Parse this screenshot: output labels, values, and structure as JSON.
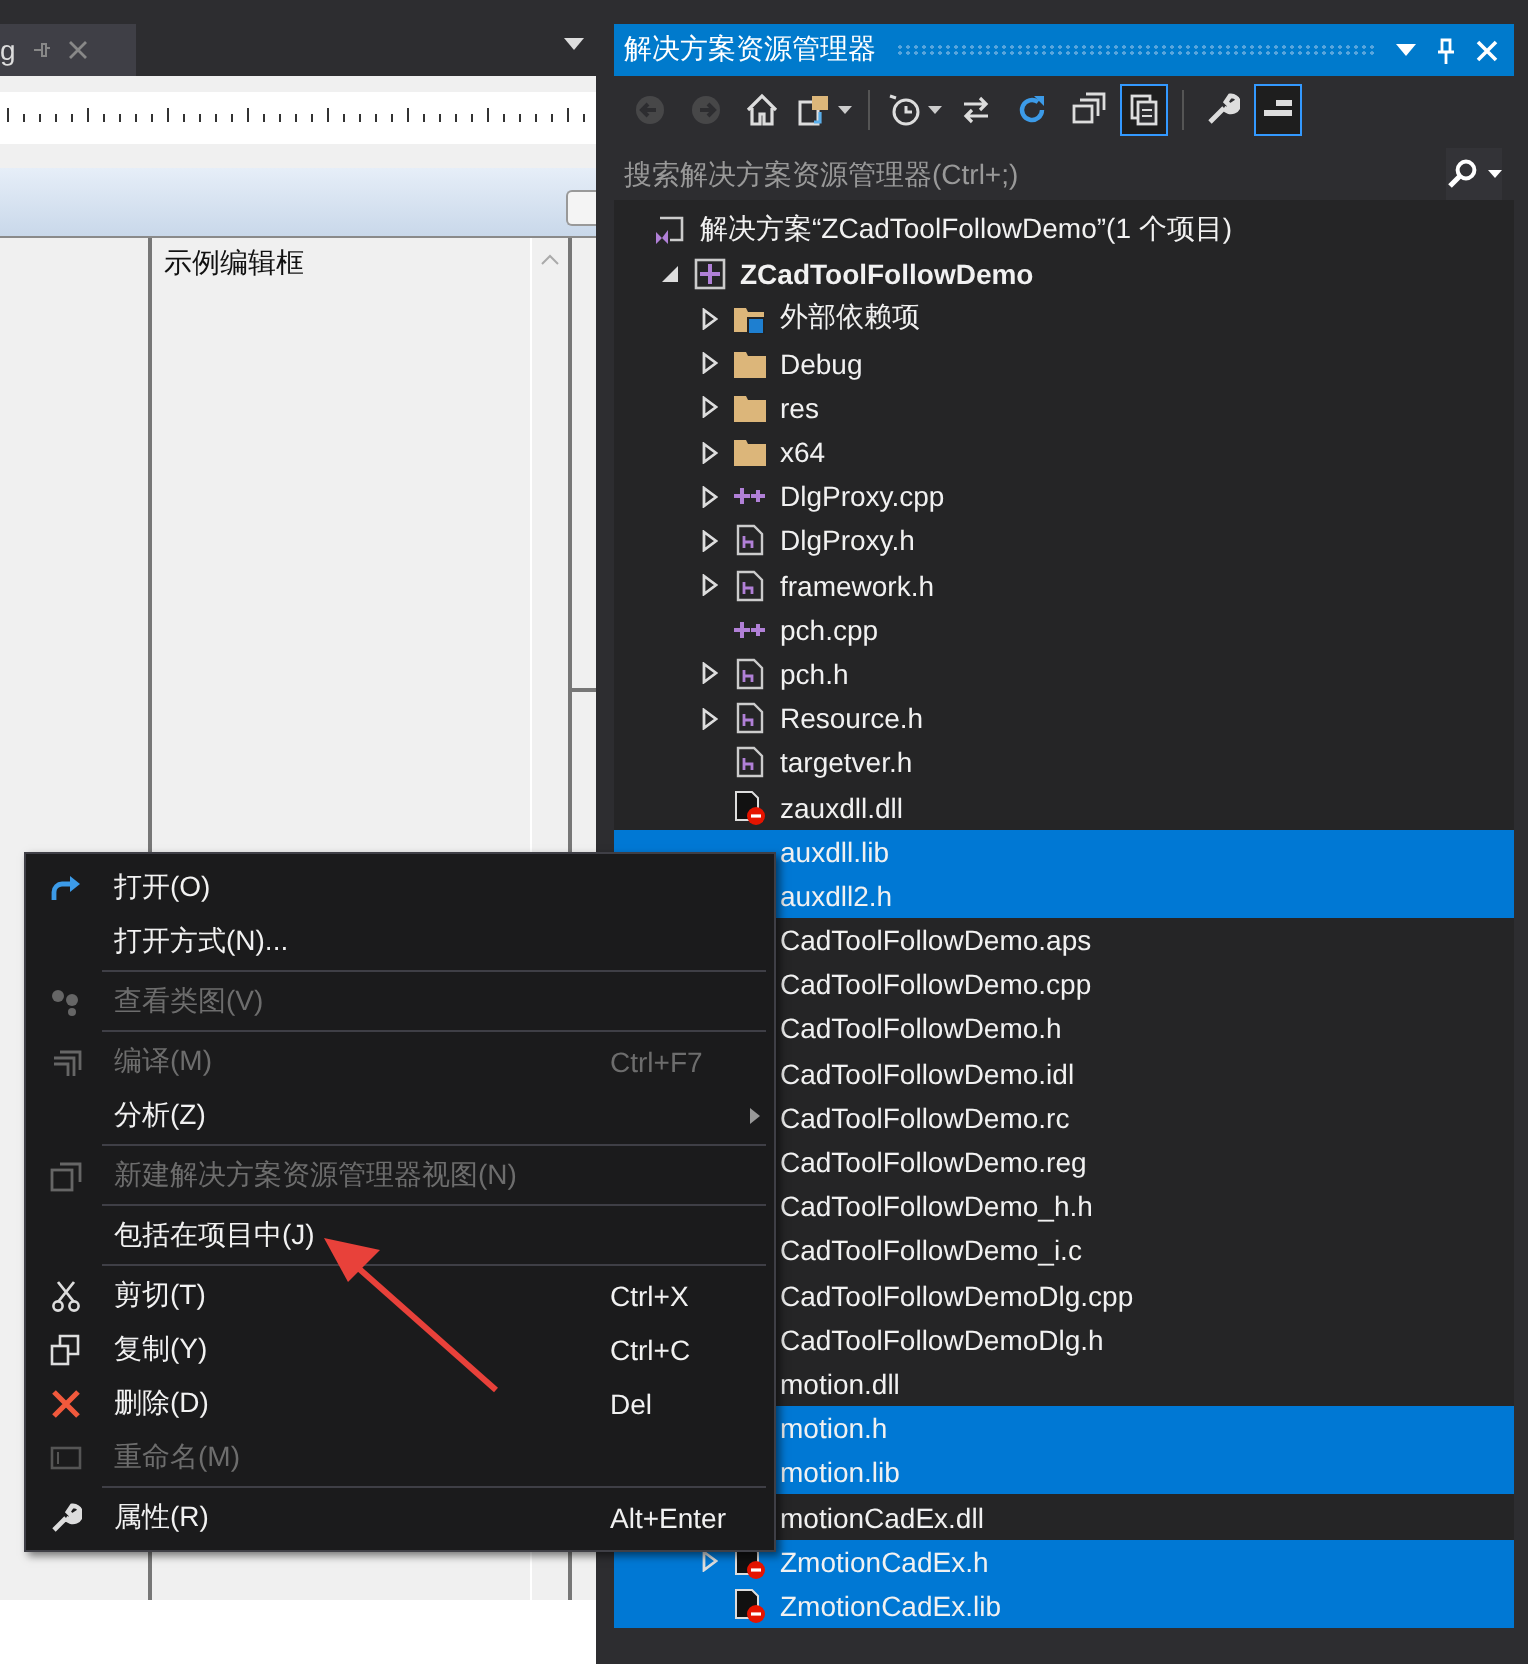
{
  "document_tab": {
    "label": "g"
  },
  "designer": {
    "edit_label": "示例编辑框"
  },
  "solution_explorer": {
    "title": "解决方案资源管理器",
    "toolbar": [
      {
        "kind": "back",
        "disabled": true,
        "toggled": false
      },
      {
        "kind": "forward",
        "disabled": true,
        "toggled": false
      },
      {
        "kind": "home",
        "disabled": false,
        "toggled": false
      },
      {
        "kind": "views",
        "disabled": false,
        "toggled": false
      },
      {
        "kind": "separator"
      },
      {
        "kind": "history",
        "disabled": false,
        "toggled": false
      },
      {
        "kind": "sync",
        "disabled": false,
        "toggled": false
      },
      {
        "kind": "refresh",
        "disabled": false,
        "toggled": false
      },
      {
        "kind": "collapse",
        "disabled": false,
        "toggled": false
      },
      {
        "kind": "show-all",
        "disabled": false,
        "toggled": true
      },
      {
        "kind": "separator"
      },
      {
        "kind": "properties",
        "disabled": false,
        "toggled": false
      },
      {
        "kind": "preview",
        "disabled": false,
        "toggled": true
      }
    ],
    "search": {
      "placeholder": "搜索解决方案资源管理器(Ctrl+;)"
    },
    "tree": [
      {
        "name": "解决方案“ZCadToolFollowDemo”(1 个项目)",
        "kind": "solution",
        "selected": false,
        "children": [
          {
            "name": "ZCadToolFollowDemo",
            "kind": "project",
            "expanded": true,
            "selected": false,
            "children": [
              {
                "name": "外部依赖项",
                "kind": "references",
                "expanded": false,
                "selected": false
              },
              {
                "name": "Debug",
                "kind": "folder",
                "expanded": false,
                "selected": false
              },
              {
                "name": "res",
                "kind": "folder",
                "expanded": false,
                "selected": false
              },
              {
                "name": "x64",
                "kind": "folder",
                "expanded": false,
                "selected": false
              },
              {
                "name": "DlgProxy.cpp",
                "kind": "cpp",
                "expanded": false,
                "selected": false
              },
              {
                "name": "DlgProxy.h",
                "kind": "header",
                "expanded": false,
                "selected": false
              },
              {
                "name": "framework.h",
                "kind": "header",
                "expanded": false,
                "selected": false
              },
              {
                "name": "pch.cpp",
                "kind": "cpp",
                "selected": false
              },
              {
                "name": "pch.h",
                "kind": "header",
                "expanded": false,
                "selected": false
              },
              {
                "name": "Resource.h",
                "kind": "header",
                "expanded": false,
                "selected": false
              },
              {
                "name": "targetver.h",
                "kind": "header",
                "selected": false
              },
              {
                "name": "zauxdll.dll",
                "kind": "excluded",
                "selected": false
              },
              {
                "name": "auxdll.lib",
                "selected": true
              },
              {
                "name": "auxdll2.h",
                "selected": true
              },
              {
                "name": "CadToolFollowDemo.aps",
                "selected": false
              },
              {
                "name": "CadToolFollowDemo.cpp",
                "selected": false
              },
              {
                "name": "CadToolFollowDemo.h",
                "selected": false
              },
              {
                "name": "CadToolFollowDemo.idl",
                "selected": false
              },
              {
                "name": "CadToolFollowDemo.rc",
                "selected": false
              },
              {
                "name": "CadToolFollowDemo.reg",
                "selected": false
              },
              {
                "name": "CadToolFollowDemo_h.h",
                "selected": false
              },
              {
                "name": "CadToolFollowDemo_i.c",
                "selected": false
              },
              {
                "name": "CadToolFollowDemoDlg.cpp",
                "selected": false
              },
              {
                "name": "CadToolFollowDemoDlg.h",
                "selected": false
              },
              {
                "name": "motion.dll",
                "selected": false
              },
              {
                "name": "motion.h",
                "selected": true
              },
              {
                "name": "motion.lib",
                "selected": true
              },
              {
                "name": "motionCadEx.dll",
                "selected": false
              },
              {
                "name": "ZmotionCadEx.h",
                "kind": "excluded",
                "expanded": false,
                "selected": true
              },
              {
                "name": "ZmotionCadEx.lib",
                "kind": "excluded",
                "selected": true
              }
            ]
          }
        ]
      }
    ]
  },
  "context_menu": {
    "groups": [
      [
        {
          "kind": "open",
          "label": "打开(O)",
          "disabled": false,
          "submenu": false
        },
        {
          "label": "打开方式(N)...",
          "disabled": false,
          "submenu": false
        }
      ],
      [
        {
          "kind": "class-view",
          "label": "查看类图(V)",
          "disabled": true,
          "submenu": false
        }
      ],
      [
        {
          "kind": "build",
          "label": "编译(M)",
          "shortcut": "Ctrl+F7",
          "disabled": true,
          "submenu": false
        },
        {
          "label": "分析(Z)",
          "disabled": false,
          "submenu": true
        }
      ],
      [
        {
          "kind": "new-view",
          "label": "新建解决方案资源管理器视图(N)",
          "disabled": true,
          "submenu": false
        }
      ],
      [
        {
          "label": "包括在项目中(J)",
          "disabled": false,
          "submenu": false
        }
      ],
      [
        {
          "kind": "cut",
          "label": "剪切(T)",
          "shortcut": "Ctrl+X",
          "disabled": false,
          "submenu": false
        },
        {
          "kind": "copy",
          "label": "复制(Y)",
          "shortcut": "Ctrl+C",
          "disabled": false,
          "submenu": false
        },
        {
          "kind": "delete",
          "label": "删除(D)",
          "shortcut": "Del",
          "disabled": false,
          "submenu": false
        },
        {
          "kind": "rename",
          "label": "重命名(M)",
          "disabled": true,
          "submenu": false
        }
      ],
      [
        {
          "kind": "properties",
          "label": "属性(R)",
          "shortcut": "Alt+Enter",
          "disabled": false,
          "submenu": false
        }
      ]
    ]
  }
}
